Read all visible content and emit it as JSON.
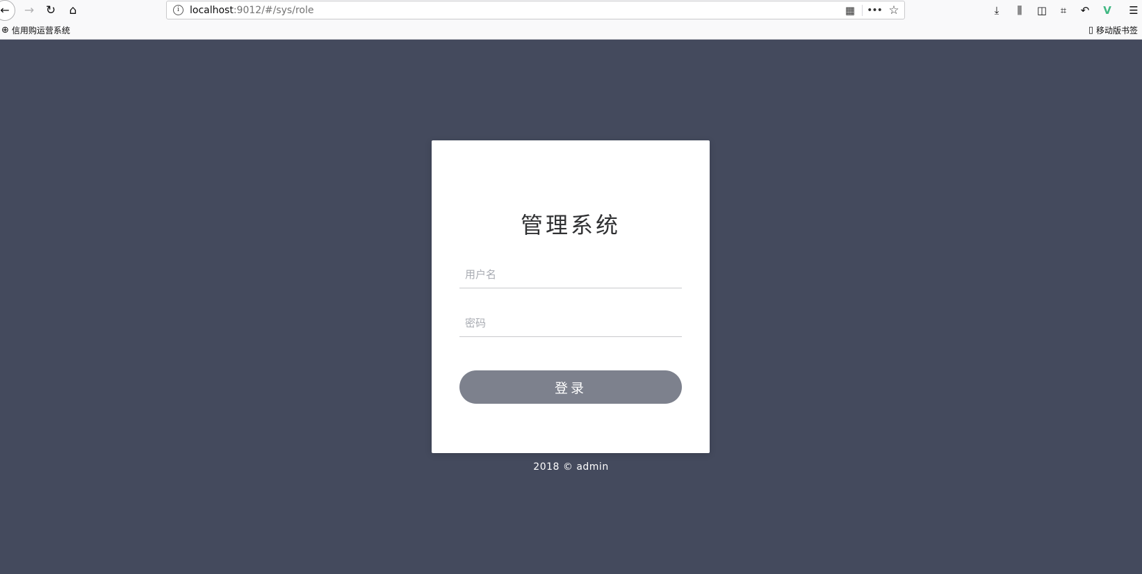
{
  "browser": {
    "url_host": "localhost",
    "url_rest": ":9012/#/sys/role",
    "icons": {
      "back": "←",
      "forward": "→",
      "reload": "↻",
      "home": "⌂",
      "info": "i",
      "qr": "▦",
      "more": "•••",
      "star": "☆",
      "download": "⤓",
      "library": "⫼",
      "sidebar": "◫",
      "crop": "⌗",
      "undo": "↶",
      "vue": "V",
      "menu": "☰"
    }
  },
  "bookmarks": {
    "items": [
      {
        "label": "信用购运营系统",
        "icon": "⊕"
      }
    ],
    "mobile": {
      "label": "移动版书签",
      "icon": "▯"
    }
  },
  "login": {
    "title": "管理系统",
    "username_placeholder": "用户名",
    "password_placeholder": "密码",
    "submit_label": "登录"
  },
  "footer": {
    "text": "2018 © admin"
  },
  "colors": {
    "background": "#444a5d",
    "button": "#7d818d",
    "vue_icon": "#41b883"
  }
}
